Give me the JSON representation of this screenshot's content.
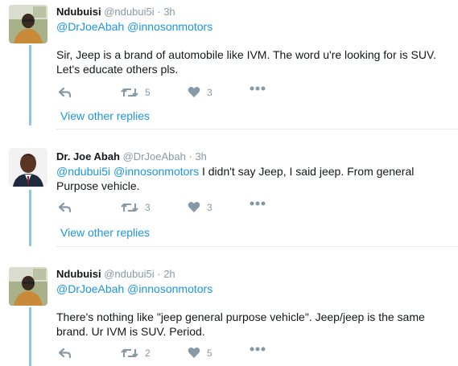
{
  "tweets": [
    {
      "name": "Ndubuisi",
      "handle": "@ndubui5i",
      "dot": "·",
      "time": "3h",
      "mention1": "@DrJoeAbah",
      "mention2": "@innosonmotors",
      "text": "Sir, Jeep is a brand of automobile like IVM. The word u're looking for is SUV. Let's educate others pls.",
      "retweets": "5",
      "likes": "3"
    },
    {
      "name": "Dr. Joe Abah",
      "handle": "@DrJoeAbah",
      "dot": "·",
      "time": "3h",
      "mention1": "@ndubui5i",
      "mention2": "@innosonmotors",
      "text": "I didn't say Jeep, I said jeep. From general Purpose vehicle.",
      "retweets": "3",
      "likes": "3"
    },
    {
      "name": "Ndubuisi",
      "handle": "@ndubui5i",
      "dot": "·",
      "time": "2h",
      "mention1": "@DrJoeAbah",
      "mention2": "@innosonmotors",
      "text": "There's nothing like \"jeep general purpose vehicle\". Jeep/jeep is the same brand. Ur IVM is SUV. Period.",
      "retweets": "2",
      "likes": "5"
    }
  ],
  "view_other_replies": "View other replies",
  "icons": {
    "reply": "reply-icon",
    "retweet": "retweet-icon",
    "like": "heart-icon",
    "more": "more-icon"
  },
  "colors": {
    "link": "#1b95e0",
    "muted": "#8899a6",
    "thread": "#8ec7d8"
  }
}
